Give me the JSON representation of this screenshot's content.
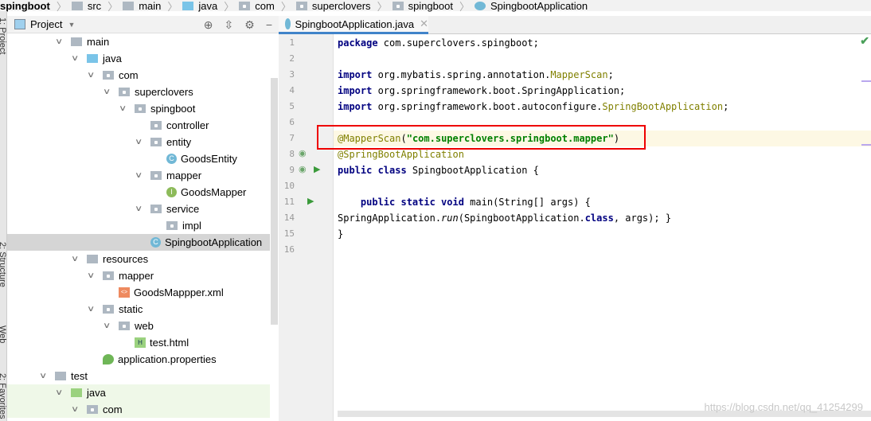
{
  "breadcrumb": [
    "spingboot",
    "src",
    "main",
    "java",
    "com",
    "superclovers",
    "spingboot",
    "SpingbootApplication"
  ],
  "side_strip": [
    "1: Project",
    "2: Structure",
    "Web",
    "2: Favorites"
  ],
  "project_panel": {
    "title": "Project",
    "tools": [
      "locate-icon",
      "collapse-icon",
      "gear-icon",
      "minimize-icon"
    ]
  },
  "tree": [
    {
      "label": "main",
      "level": 0,
      "icon": "folder",
      "expanded": true
    },
    {
      "label": "java",
      "level": 1,
      "icon": "folder-blue",
      "expanded": true
    },
    {
      "label": "com",
      "level": 2,
      "icon": "package",
      "expanded": true
    },
    {
      "label": "superclovers",
      "level": 3,
      "icon": "package",
      "expanded": true
    },
    {
      "label": "spingboot",
      "level": 4,
      "icon": "package",
      "expanded": true
    },
    {
      "label": "controller",
      "level": 5,
      "icon": "package"
    },
    {
      "label": "entity",
      "level": 5,
      "icon": "package",
      "expanded": true
    },
    {
      "label": "GoodsEntity",
      "level": 6,
      "icon": "class"
    },
    {
      "label": "mapper",
      "level": 5,
      "icon": "package",
      "expanded": true
    },
    {
      "label": "GoodsMapper",
      "level": 6,
      "icon": "interface"
    },
    {
      "label": "service",
      "level": 5,
      "icon": "package",
      "expanded": true
    },
    {
      "label": "impl",
      "level": 6,
      "icon": "package"
    },
    {
      "label": "SpingbootApplication",
      "level": 5,
      "icon": "spring-class",
      "selected": true
    },
    {
      "label": "resources",
      "level": 1,
      "icon": "folder",
      "expanded": true
    },
    {
      "label": "mapper",
      "level": 2,
      "icon": "package",
      "expanded": true
    },
    {
      "label": "GoodsMappper.xml",
      "level": 3,
      "icon": "xml"
    },
    {
      "label": "static",
      "level": 2,
      "icon": "package",
      "expanded": true
    },
    {
      "label": "web",
      "level": 3,
      "icon": "package",
      "expanded": true
    },
    {
      "label": "test.html",
      "level": 4,
      "icon": "html"
    },
    {
      "label": "application.properties",
      "level": 2,
      "icon": "properties"
    },
    {
      "label": "test",
      "level": -1,
      "icon": "folder",
      "expanded": true
    },
    {
      "label": "java",
      "level": 0,
      "icon": "folder-green",
      "expanded": true,
      "test": true
    },
    {
      "label": "com",
      "level": 1,
      "icon": "package",
      "expanded": true,
      "test": true
    }
  ],
  "editor": {
    "tab": "SpingbootApplication.java",
    "lines": [
      {
        "n": "1",
        "html": "<span class='kw'>package</span> com.superclovers.spingboot;"
      },
      {
        "n": "2",
        "html": ""
      },
      {
        "n": "3",
        "html": "<span class='kw'>import</span> org.mybatis.spring.annotation.<span class='ann'>MapperScan</span>;"
      },
      {
        "n": "4",
        "html": "<span class='kw'>import</span> org.springframework.boot.SpringApplication;"
      },
      {
        "n": "5",
        "html": "<span class='kw'>import</span> org.springframework.boot.autoconfigure.<span class='ann'>SpringBootApplication</span>;"
      },
      {
        "n": "6",
        "html": ""
      },
      {
        "n": "7",
        "html": "<span class='ann'>@MapperScan</span>(<span class='str'>\"com.superclovers.springboot.mapper\"</span>)",
        "current": true
      },
      {
        "n": "8",
        "html": "<span class='ann'>@SpringBootApplication</span>"
      },
      {
        "n": "9",
        "html": "<span class='kw'>public class</span> SpingbootApplication {"
      },
      {
        "n": "10",
        "html": ""
      },
      {
        "n": "11",
        "html": "    <span class='kw'>public static void</span> main(String[] args) { SpringApplication.<span class='it'>run</span>(SpingbootApplication.<span class='kw'>class</span>, args); }"
      },
      {
        "n": "14",
        "html": ""
      },
      {
        "n": "15",
        "html": "}"
      },
      {
        "n": "16",
        "html": ""
      }
    ]
  },
  "watermark": "https://blog.csdn.net/qq_41254299",
  "colors": {
    "highlight_box": "#ee0000",
    "keyword": "#000080",
    "annotation": "#808000",
    "string": "#008000"
  }
}
